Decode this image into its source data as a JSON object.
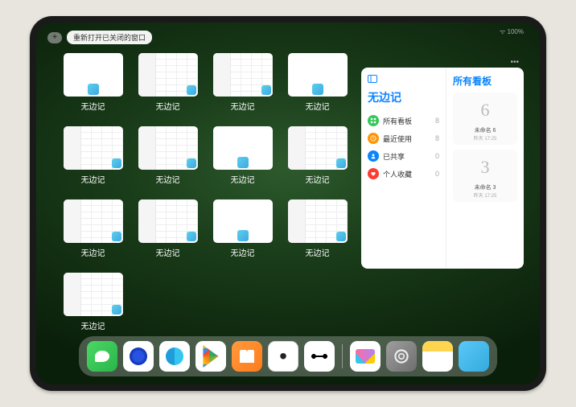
{
  "status": {
    "signal": "•••",
    "battery": "100%"
  },
  "topbar": {
    "plus": "+",
    "reopen_label": "重新打开已关闭的窗口"
  },
  "tiles": {
    "label": "无边记",
    "items": [
      {
        "variant": "blank"
      },
      {
        "variant": "grid"
      },
      {
        "variant": "grid"
      },
      {
        "variant": "blank"
      },
      {
        "variant": "grid"
      },
      {
        "variant": "grid"
      },
      {
        "variant": "blank"
      },
      {
        "variant": "grid"
      },
      {
        "variant": "grid"
      },
      {
        "variant": "grid"
      },
      {
        "variant": "blank"
      },
      {
        "variant": "grid"
      },
      {
        "variant": "grid"
      }
    ]
  },
  "panel": {
    "title": "无边记",
    "right_title": "所有看板",
    "rows": [
      {
        "icon": "grid",
        "color": "#34c759",
        "label": "所有看板",
        "count": "8"
      },
      {
        "icon": "clock",
        "color": "#ff9500",
        "label": "最近使用",
        "count": "8"
      },
      {
        "icon": "people",
        "color": "#0a84ff",
        "label": "已共享",
        "count": "0"
      },
      {
        "icon": "heart",
        "color": "#ff3b30",
        "label": "个人收藏",
        "count": "0"
      }
    ],
    "boards": [
      {
        "sketch": "6",
        "name": "未命名 6",
        "sub": "昨天 17:25"
      },
      {
        "sketch": "3",
        "name": "未命名 3",
        "sub": "昨天 17:25"
      }
    ]
  },
  "dock": [
    {
      "name": "wechat-icon"
    },
    {
      "name": "qq-blue-icon"
    },
    {
      "name": "qq-browser-icon"
    },
    {
      "name": "play-store-icon"
    },
    {
      "name": "books-icon"
    },
    {
      "name": "dice-icon"
    },
    {
      "name": "connect-icon"
    },
    {
      "name": "freeform-icon"
    },
    {
      "name": "settings-icon"
    },
    {
      "name": "notes-icon"
    },
    {
      "name": "launchpad-icon"
    }
  ]
}
